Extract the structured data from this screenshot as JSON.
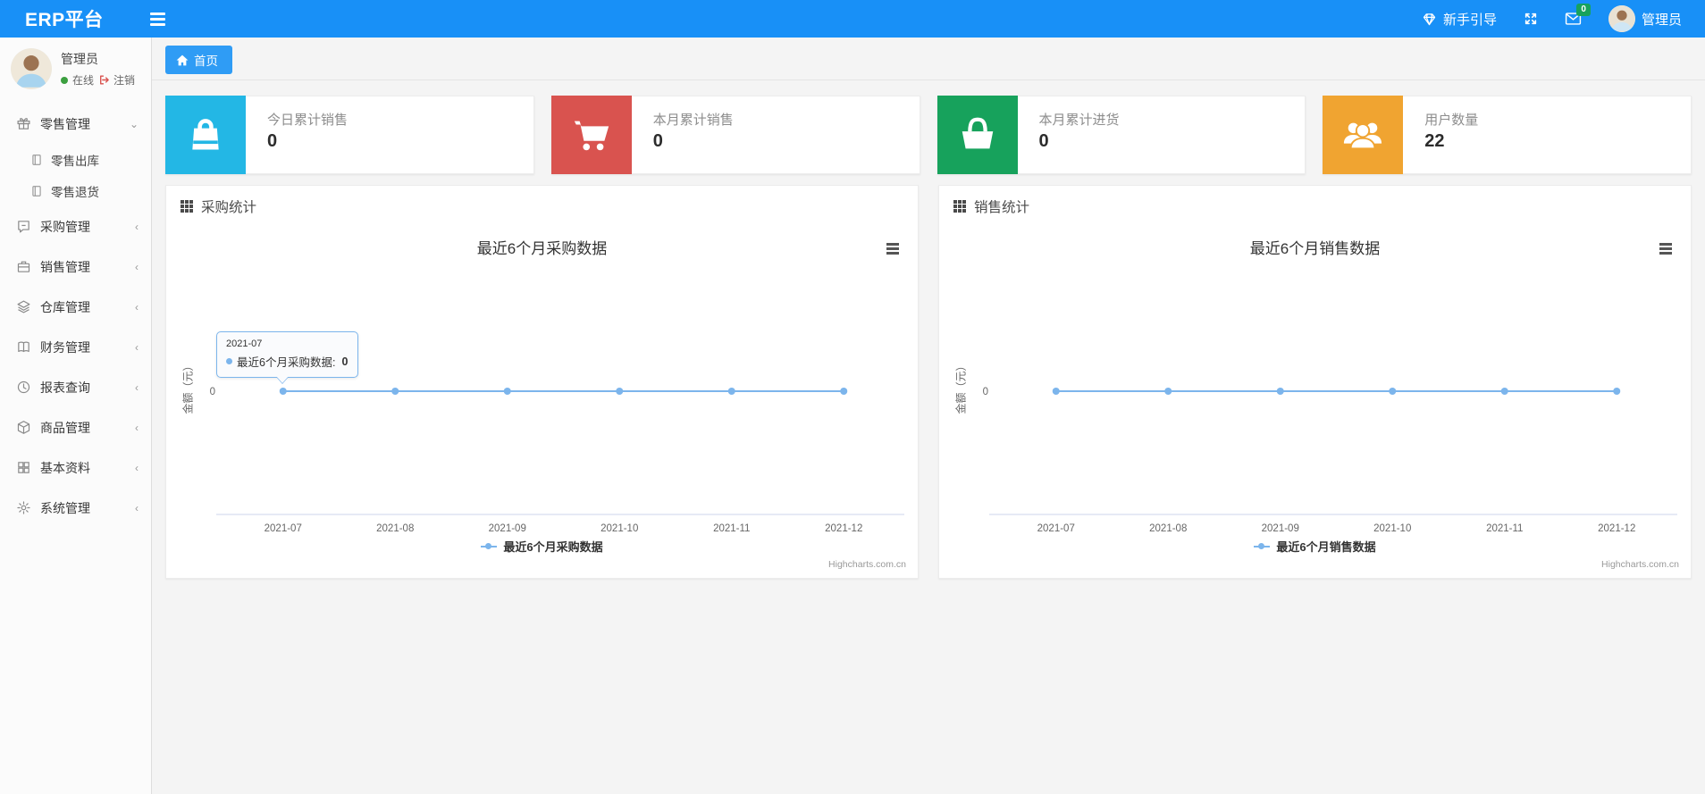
{
  "navbar": {
    "brand": "ERP平台",
    "guide_label": "新手引导",
    "mail_badge": "0",
    "username": "管理员"
  },
  "sidebar": {
    "user": {
      "name": "管理员",
      "status": "在线",
      "logout_label": "注销"
    },
    "menu": [
      {
        "label": "零售管理",
        "expanded": true,
        "children": [
          {
            "label": "零售出库"
          },
          {
            "label": "零售退货"
          }
        ]
      },
      {
        "label": "采购管理",
        "expanded": false
      },
      {
        "label": "销售管理",
        "expanded": false
      },
      {
        "label": "仓库管理",
        "expanded": false
      },
      {
        "label": "财务管理",
        "expanded": false
      },
      {
        "label": "报表查询",
        "expanded": false
      },
      {
        "label": "商品管理",
        "expanded": false
      },
      {
        "label": "基本资料",
        "expanded": false
      },
      {
        "label": "系统管理",
        "expanded": false
      }
    ]
  },
  "tabs": {
    "home": "首页"
  },
  "stats": [
    {
      "label": "今日累计销售",
      "value": "0",
      "color": "#23b7e5"
    },
    {
      "label": "本月累计销售",
      "value": "0",
      "color": "#d9534f"
    },
    {
      "label": "本月累计进货",
      "value": "0",
      "color": "#17a25c"
    },
    {
      "label": "用户数量",
      "value": "22",
      "color": "#f0a431"
    }
  ],
  "panels": [
    {
      "header": "采购统计"
    },
    {
      "header": "销售统计"
    }
  ],
  "chart_data": [
    {
      "type": "line",
      "title": "最近6个月采购数据",
      "ylabel": "金额（元）",
      "categories": [
        "2021-07",
        "2021-08",
        "2021-09",
        "2021-10",
        "2021-11",
        "2021-12"
      ],
      "series": [
        {
          "name": "最近6个月采购数据",
          "values": [
            0,
            0,
            0,
            0,
            0,
            0
          ],
          "color": "#7cb5ec"
        }
      ],
      "yticks": [
        "0"
      ],
      "ylim": [
        -1,
        1
      ],
      "grid": false,
      "legend_position": "bottom",
      "credits": "Highcharts.com.cn",
      "tooltip": {
        "header": "2021-07",
        "label": "最近6个月采购数据:",
        "value": "0"
      }
    },
    {
      "type": "line",
      "title": "最近6个月销售数据",
      "ylabel": "金额（元）",
      "categories": [
        "2021-07",
        "2021-08",
        "2021-09",
        "2021-10",
        "2021-11",
        "2021-12"
      ],
      "series": [
        {
          "name": "最近6个月销售数据",
          "values": [
            0,
            0,
            0,
            0,
            0,
            0
          ],
          "color": "#7cb5ec"
        }
      ],
      "yticks": [
        "0"
      ],
      "ylim": [
        -1,
        1
      ],
      "grid": false,
      "legend_position": "bottom",
      "credits": "Highcharts.com.cn"
    }
  ]
}
